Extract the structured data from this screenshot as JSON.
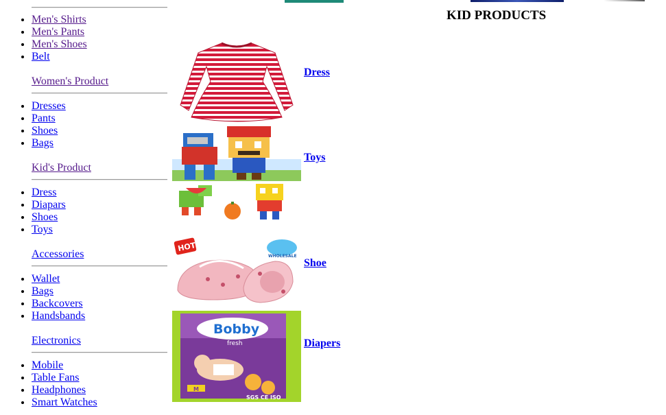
{
  "page": {
    "title": "KID PRODUCTS"
  },
  "sidebar": {
    "mens": {
      "items": [
        "Men's Shirts",
        "Men's Pants",
        "Men's Shoes",
        "Belt"
      ]
    },
    "womens": {
      "heading": "Women's Product",
      "items": [
        "Dresses",
        "Pants",
        "Shoes",
        "Bags"
      ]
    },
    "kids": {
      "heading": "Kid's Product",
      "items": [
        "Dress",
        "Diapars",
        "Shoes",
        "Toys"
      ]
    },
    "accessories": {
      "heading": "Accessories",
      "items": [
        "Wallet",
        "Bags",
        "Backcovers",
        "Handsbands"
      ]
    },
    "electronics": {
      "heading": "Electronics",
      "items": [
        "Mobile",
        "Table Fans",
        "Headphones",
        "Smart Watches"
      ]
    }
  },
  "products": [
    {
      "label": "Dress",
      "image": "red-striped-dress-image"
    },
    {
      "label": "Toys",
      "image": "block-toys-image"
    },
    {
      "label": "Shoe",
      "image": "pink-baby-shoes-image"
    },
    {
      "label": "Diapers",
      "image": "bobby-diapers-pack-image"
    }
  ],
  "image_text": {
    "hot_badge": "HOT",
    "wholesale_badge": "WHOLESALE",
    "diaper_brand": "Bobby",
    "diaper_sub": "fresh",
    "diaper_size": "M",
    "cert_marks": "SGS CE ISO"
  },
  "colors": {
    "link": "#0000ee",
    "visited_link": "#551a8b",
    "rule": "#9a9a9a"
  }
}
